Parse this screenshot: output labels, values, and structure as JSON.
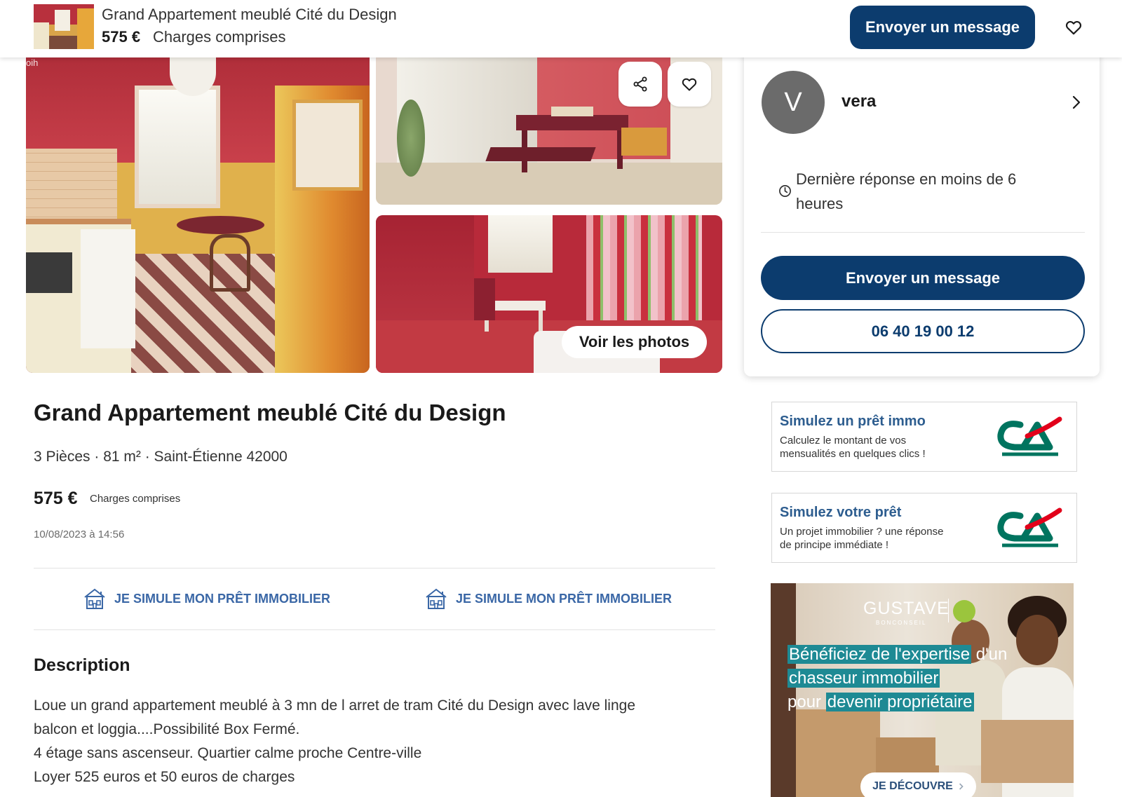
{
  "colors": {
    "primary": "#0c3c6e",
    "link": "#3a67a6",
    "ad_title": "#2d5d8f",
    "banner_highlight": "#1e8a94",
    "avatar": "#6b6b6b"
  },
  "header": {
    "title": "Grand Appartement meublé Cité du Design",
    "price": "575 €",
    "charges": "Charges comprises",
    "message_button": "Envoyer un message",
    "favorite_icon": "heart-icon"
  },
  "gallery": {
    "watermark": "oih",
    "share_icon": "share-icon",
    "favorite_icon": "heart-icon",
    "see_photos_label": "Voir les photos"
  },
  "seller": {
    "avatar_letter": "V",
    "name": "vera",
    "response_time": "Dernière réponse en moins de 6 heures",
    "message_button": "Envoyer un message",
    "phone": "06 40 19 00 12"
  },
  "listing": {
    "title": "Grand Appartement meublé Cité du Design",
    "details": "3 Pièces · 81 m² · Saint-Étienne 42000",
    "price": "575 €",
    "charges": "Charges comprises",
    "date": "10/08/2023 à 14:56",
    "loan_links": [
      "JE SIMULE MON PRÊT IMMOBILIER",
      "JE SIMULE MON PRÊT IMMOBILIER"
    ],
    "description_heading": "Description",
    "description_lines": [
      "Loue un grand appartement meublé à 3 mn de l arret de tram Cité du Design avec lave linge",
      "balcon et loggia....Possibilité Box Fermé.",
      "4 étage sans ascenseur. Quartier calme proche Centre-ville",
      "Loyer 525 euros et 50 euros de charges"
    ]
  },
  "ads": {
    "cards": [
      {
        "title": "Simulez un prêt immo",
        "lines": [
          "Calculez le montant de vos",
          "mensualités en quelques clics !"
        ],
        "logo_icon": "ca-logo"
      },
      {
        "title": "Simulez votre prêt",
        "lines": [
          "Un projet immobilier ? une réponse",
          "de principe immédiate !"
        ],
        "logo_icon": "ca-logo"
      }
    ],
    "banner": {
      "brand": "GUSTAVE",
      "brand_sub": "BONCONSEIL",
      "headline": [
        "Bénéficiez de l'expertise",
        "d'un",
        "chasseur immobilier",
        "pour",
        "devenir propriétaire"
      ],
      "cta": "JE DÉCOUVRE"
    }
  }
}
